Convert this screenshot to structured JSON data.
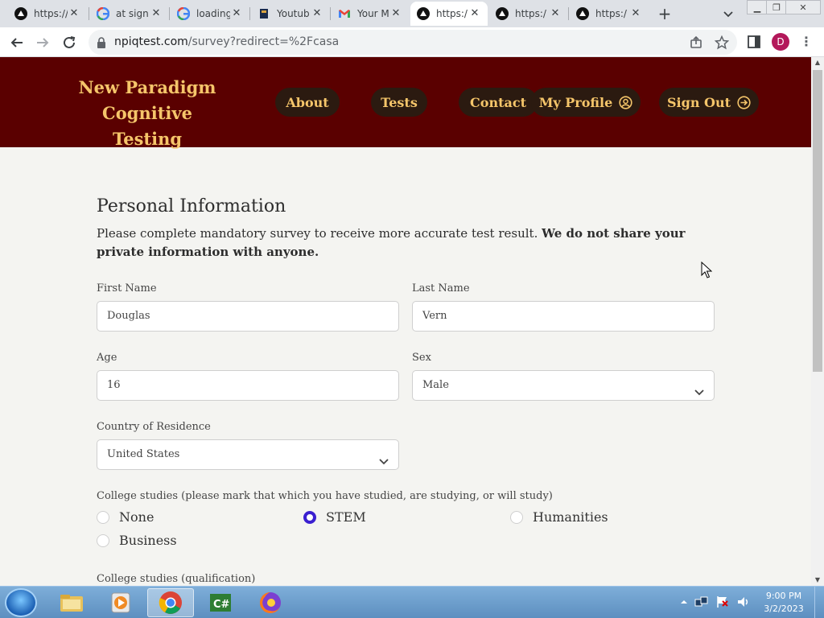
{
  "browser": {
    "tabs": [
      {
        "title": "https://",
        "icon": "vercel-triangle-icon",
        "active": false
      },
      {
        "title": "at sign",
        "icon": "google-g-icon",
        "active": false
      },
      {
        "title": "loading",
        "icon": "google-g-icon",
        "active": false
      },
      {
        "title": "Youtub",
        "icon": "book-icon",
        "active": false
      },
      {
        "title": "Your M",
        "icon": "gmail-icon",
        "active": false
      },
      {
        "title": "https:/",
        "icon": "vercel-triangle-icon",
        "active": true
      },
      {
        "title": "https:/",
        "icon": "vercel-triangle-icon",
        "active": false
      },
      {
        "title": "https:/",
        "icon": "vercel-triangle-icon",
        "active": false
      }
    ],
    "url_host": "npiqtest.com",
    "url_path": "/survey?redirect=%2Fcasa",
    "profile_initial": "D"
  },
  "site": {
    "brand_line1": "New Paradigm",
    "brand_line2": "Cognitive Testing",
    "nav": {
      "about": "About",
      "tests": "Tests",
      "contact": "Contact",
      "my_profile": "My Profile",
      "sign_out": "Sign Out"
    }
  },
  "form": {
    "title": "Personal Information",
    "intro_normal": "Please complete mandatory survey to receive more accurate test result.",
    "intro_bold": "We do not share your private information with anyone.",
    "first_name_label": "First Name",
    "first_name_value": "Douglas",
    "last_name_label": "Last Name",
    "last_name_value": "Vern",
    "age_label": "Age",
    "age_value": "16",
    "sex_label": "Sex",
    "sex_value": "Male",
    "country_label": "Country of Residence",
    "country_value": "United States",
    "college_label": "College studies (please mark that which you have studied, are studying, or will study)",
    "college_options": [
      {
        "label": "None",
        "selected": false
      },
      {
        "label": "STEM",
        "selected": true
      },
      {
        "label": "Humanities",
        "selected": false
      },
      {
        "label": "Business",
        "selected": false
      }
    ],
    "qualification_label": "College studies (qualification)"
  },
  "taskbar": {
    "time": "9:00 PM",
    "date": "3/2/2023",
    "apps": [
      "explorer-folder-icon",
      "media-player-icon",
      "chrome-icon",
      "csharp-icon",
      "firefox-icon"
    ]
  },
  "colors": {
    "header_bg": "#5a0000",
    "accent_gold": "#f5c56a",
    "radio_selected": "#3a1fd0",
    "page_bg": "#f4f4f1"
  }
}
